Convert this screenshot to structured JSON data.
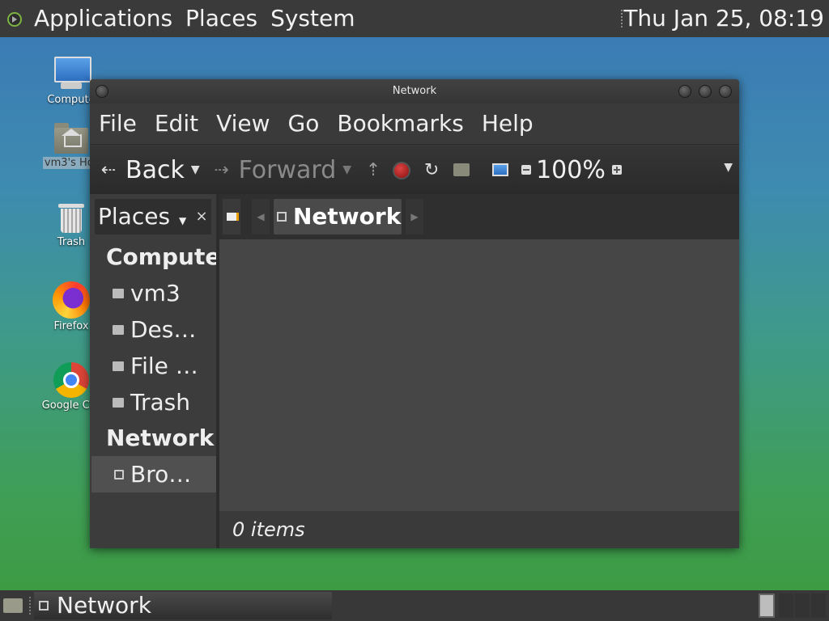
{
  "top_panel": {
    "menus": [
      "Applications",
      "Places",
      "System"
    ],
    "clock": "Thu Jan 25, 08:19"
  },
  "desktop": {
    "icons": [
      {
        "label": "Compute",
        "icon": "computer-icon"
      },
      {
        "label": "vm3's Hor",
        "icon": "home-folder-icon"
      },
      {
        "label": "Trash",
        "icon": "trash-icon"
      },
      {
        "label": "Firefox",
        "icon": "firefox-icon"
      },
      {
        "label": "Google Chr",
        "icon": "chrome-icon"
      }
    ]
  },
  "window": {
    "title": "Network",
    "menubar": [
      "File",
      "Edit",
      "View",
      "Go",
      "Bookmarks",
      "Help"
    ],
    "toolbar": {
      "back": "Back",
      "forward": "Forward",
      "zoom": "100%"
    },
    "sidebar": {
      "header": "Places",
      "close": "×",
      "sections": [
        {
          "title": "Compute",
          "items": [
            "vm3",
            "Des…",
            "File …",
            "Trash"
          ]
        },
        {
          "title": "Network",
          "items": [
            "Bro…"
          ]
        }
      ]
    },
    "pathbar": {
      "crumb": "Network"
    },
    "status": "0 items"
  },
  "taskbar": {
    "task": "Network"
  },
  "colors": {
    "panel": "#3a3a3a",
    "window_bg": "#3c3c3c",
    "file_view": "#464646"
  }
}
